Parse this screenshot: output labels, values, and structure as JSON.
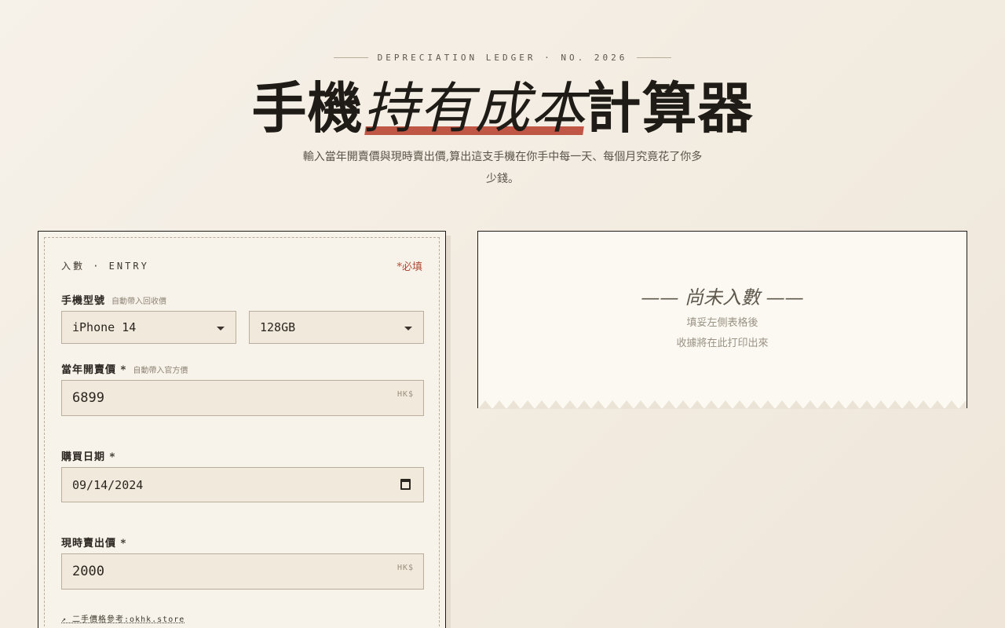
{
  "header": {
    "eyebrow": "DEPRECIATION LEDGER · NO. 2026",
    "title_prefix": "手機",
    "title_emphasis": "持有成本",
    "title_suffix": "計算器",
    "subtitle": "輸入當年開賣價與現時賣出價,算出這支手機在你手中每一天、每個月究竟花了你多少錢。"
  },
  "form": {
    "section_label": "入數 · ENTRY",
    "required_note": "*必填",
    "model": {
      "label": "手機型號",
      "hint": "自動帶入回收價",
      "selected_model": "iPhone 14",
      "selected_storage": "128GB"
    },
    "launch_price": {
      "label": "當年開賣價 *",
      "hint": "自動帶入官方價",
      "value": "6899",
      "unit": "HK$"
    },
    "purchase_date": {
      "label": "購買日期 *",
      "value": "09/14/2024"
    },
    "sell_price": {
      "label": "現時賣出價 *",
      "value": "2000",
      "unit": "HK$"
    },
    "reference_link": "↗ 二手價格參考:okhk.store"
  },
  "receipt": {
    "pending_title": "—— 尚未入數 ——",
    "hint_line1": "填妥左側表格後",
    "hint_line2": "收據將在此打印出來"
  },
  "colors": {
    "accent": "#c05646",
    "ink": "#1f1c17",
    "paper": "#f8f3ea",
    "field": "#f1e9dc"
  }
}
